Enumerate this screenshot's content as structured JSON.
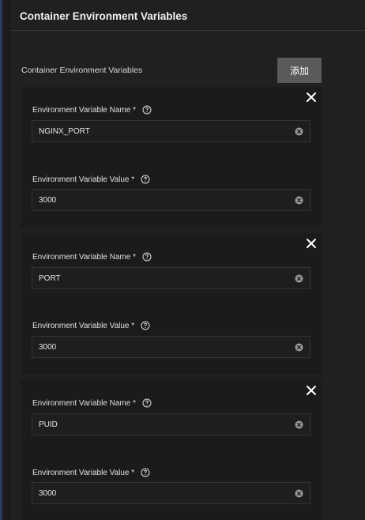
{
  "section": {
    "title": "Container Environment Variables",
    "list_label": "Container Environment Variables",
    "add_label": "添加"
  },
  "entries": [
    {
      "name_label": "Environment Variable Name *",
      "name_value": "NGINX_PORT",
      "value_label": "Environment Variable Value *",
      "value_value": "3000"
    },
    {
      "name_label": "Environment Variable Name *",
      "name_value": "PORT",
      "value_label": "Environment Variable Value *",
      "value_value": "3000"
    },
    {
      "name_label": "Environment Variable Name *",
      "name_value": "PUID",
      "value_label": "Environment Variable Value *",
      "value_value": "3000"
    }
  ],
  "icons": {
    "close": "close-icon",
    "help": "help-circle-icon",
    "clear": "clear-circle-icon"
  },
  "colors": {
    "background": "#1b1b1d",
    "card": "#202022",
    "button": "#5a5a5c",
    "accent_edge": "#2a3a5c"
  }
}
